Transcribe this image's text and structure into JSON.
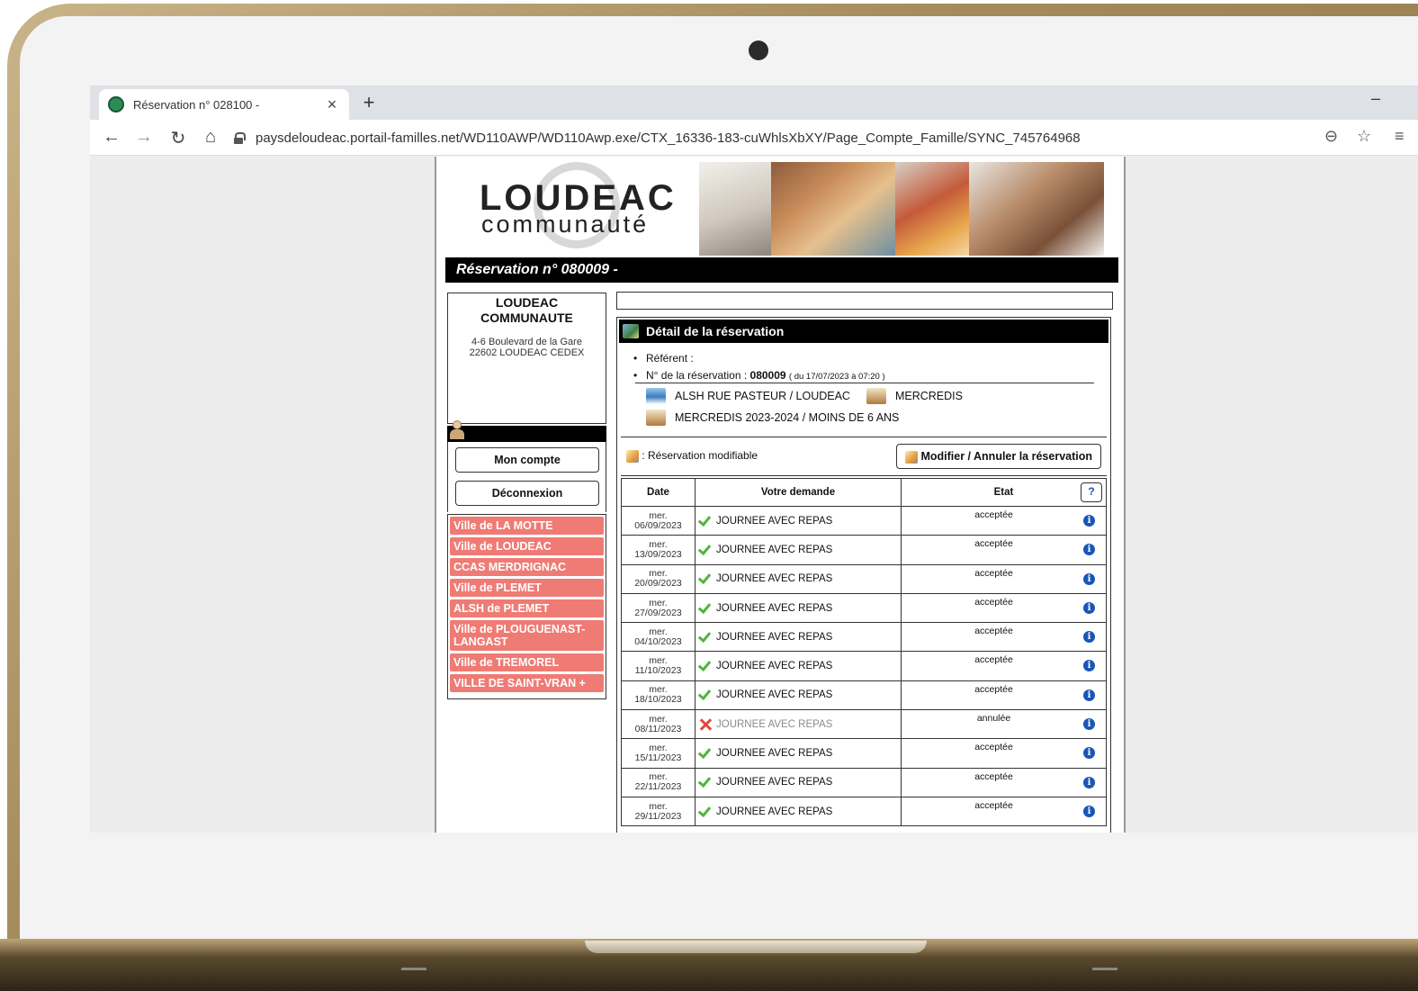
{
  "browser": {
    "tab_title": "Réservation n° 028100 -",
    "tab_close": "×",
    "new_tab": "+",
    "window_min": "–",
    "url": "paysdeloudeac.portail-familles.net/WD110AWP/WD110Awp.exe/CTX_16336-183-cuWhlsXbXY/Page_Compte_Famille/SYNC_745764968",
    "icons": [
      "back-icon",
      "forward-icon",
      "reload-icon",
      "home-icon",
      "lock-icon",
      "zoom-icon",
      "star-icon",
      "menu-icon"
    ]
  },
  "banner": {
    "logo_main": "LOUDEAC",
    "logo_sub": "communauté"
  },
  "page": {
    "title": "Réservation n° 080009 -"
  },
  "organisation": {
    "name_line1": "LOUDEAC",
    "name_line2": "COMMUNAUTE",
    "address_line1": "4-6 Boulevard de la Gare",
    "address_line2": "22602 LOUDEAC CEDEX"
  },
  "account": {
    "my_account_label": "Mon compte",
    "logout_label": "Déconnexion"
  },
  "villes": [
    "Ville de LA MOTTE",
    "Ville de LOUDEAC",
    "CCAS MERDRIGNAC",
    "Ville de PLEMET",
    "ALSH de PLEMET",
    "Ville de PLOUGUENAST-LANGAST",
    "Ville de TREMOREL",
    "VILLE DE SAINT-VRAN +"
  ],
  "detail": {
    "heading": "Détail de la réservation",
    "referent_label": "Référent :",
    "num_label": "N° de la réservation :",
    "num_value": "080009",
    "num_date": "( du 17/07/2023 à 07:20 )",
    "site": "ALSH RUE PASTEUR / LOUDEAC",
    "day": "MERCREDIS",
    "activity": "MERCREDIS 2023-2024 / MOINS DE 6 ANS",
    "modifiable_note": ": Réservation modifiable",
    "modify_button": "Modifier / Annuler la réservation"
  },
  "table": {
    "headers": {
      "date": "Date",
      "demande": "Votre demande",
      "etat": "Etat",
      "help": "?"
    },
    "info_glyph": "i",
    "rows": [
      {
        "day": "mer.",
        "date": "06/09/2023",
        "demande": "JOURNEE AVEC REPAS",
        "etat": "acceptée",
        "status": "ok"
      },
      {
        "day": "mer.",
        "date": "13/09/2023",
        "demande": "JOURNEE AVEC REPAS",
        "etat": "acceptée",
        "status": "ok"
      },
      {
        "day": "mer.",
        "date": "20/09/2023",
        "demande": "JOURNEE AVEC REPAS",
        "etat": "acceptée",
        "status": "ok"
      },
      {
        "day": "mer.",
        "date": "27/09/2023",
        "demande": "JOURNEE AVEC REPAS",
        "etat": "acceptée",
        "status": "ok"
      },
      {
        "day": "mer.",
        "date": "04/10/2023",
        "demande": "JOURNEE AVEC REPAS",
        "etat": "acceptée",
        "status": "ok"
      },
      {
        "day": "mer.",
        "date": "11/10/2023",
        "demande": "JOURNEE AVEC REPAS",
        "etat": "acceptée",
        "status": "ok"
      },
      {
        "day": "mer.",
        "date": "18/10/2023",
        "demande": "JOURNEE AVEC REPAS",
        "etat": "acceptée",
        "status": "ok"
      },
      {
        "day": "mer.",
        "date": "08/11/2023",
        "demande": "JOURNEE AVEC REPAS",
        "etat": "annulée",
        "status": "cancelled"
      },
      {
        "day": "mer.",
        "date": "15/11/2023",
        "demande": "JOURNEE AVEC REPAS",
        "etat": "acceptée",
        "status": "ok"
      },
      {
        "day": "mer.",
        "date": "22/11/2023",
        "demande": "JOURNEE AVEC REPAS",
        "etat": "acceptée",
        "status": "ok"
      },
      {
        "day": "mer.",
        "date": "29/11/2023",
        "demande": "JOURNEE AVEC REPAS",
        "etat": "acceptée",
        "status": "ok"
      }
    ]
  },
  "colors": {
    "ville_bg": "#ef7b74",
    "ok_green": "#53b33f",
    "cancel_red": "#e04a3a",
    "info_blue": "#1a56b8"
  }
}
